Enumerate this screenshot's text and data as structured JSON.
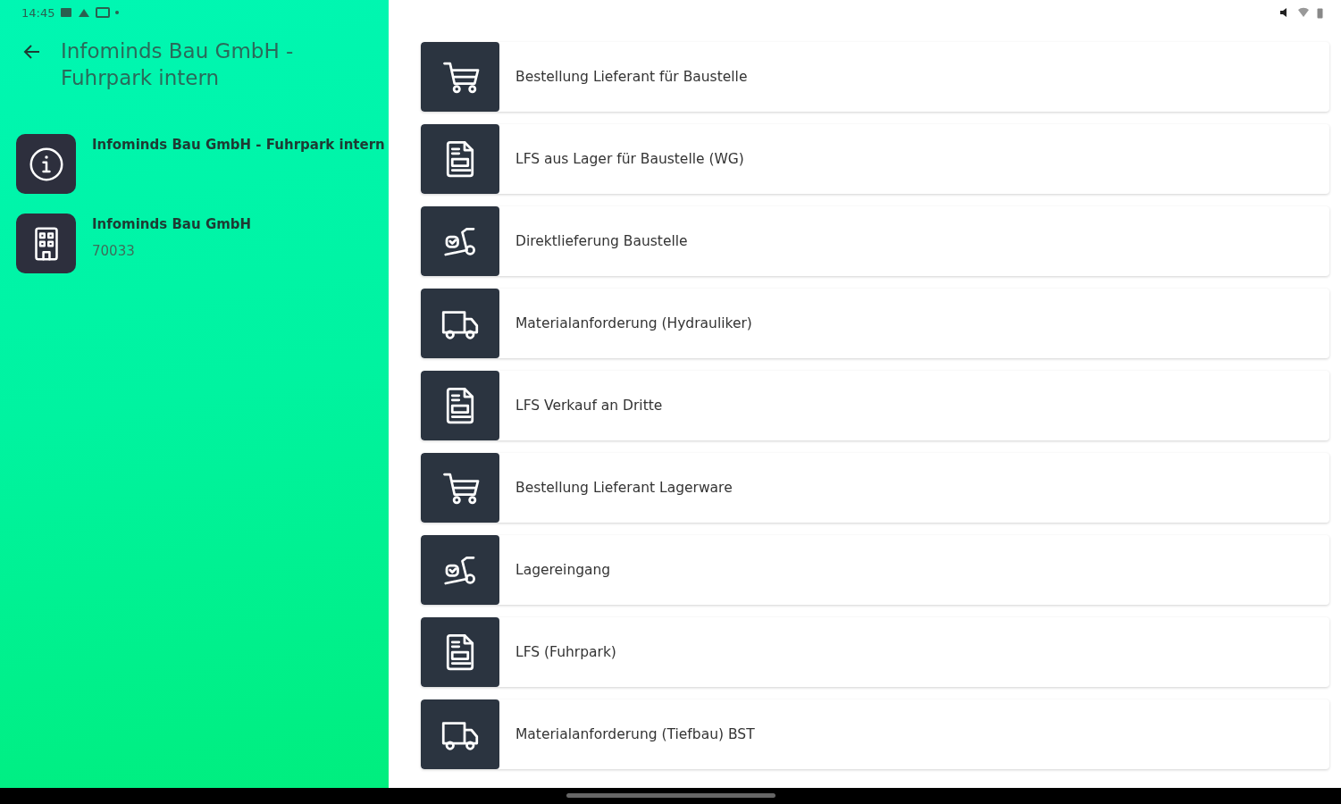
{
  "status_bar": {
    "time": "14:45"
  },
  "header": {
    "title": "Infominds Bau GmbH - Fuhrpark intern"
  },
  "info_items": [
    {
      "kind": "info",
      "title": "Infominds Bau GmbH - Fuhrpark intern"
    },
    {
      "kind": "building",
      "title": "Infominds Bau GmbH",
      "subtitle": "70033"
    }
  ],
  "documents": [
    {
      "kind": "cart",
      "label": "Bestellung Lieferant für Baustelle"
    },
    {
      "kind": "document",
      "label": "LFS aus Lager für Baustelle (WG)"
    },
    {
      "kind": "dolly",
      "label": "Direktlieferung Baustelle"
    },
    {
      "kind": "truck",
      "label": "Materialanforderung (Hydrauliker)"
    },
    {
      "kind": "document",
      "label": "LFS Verkauf an Dritte"
    },
    {
      "kind": "cart",
      "label": "Bestellung Lieferant Lagerware"
    },
    {
      "kind": "dolly",
      "label": "Lagereingang"
    },
    {
      "kind": "document",
      "label": "LFS (Fuhrpark)"
    },
    {
      "kind": "truck",
      "label": "Materialanforderung (Tiefbau) BST"
    }
  ]
}
